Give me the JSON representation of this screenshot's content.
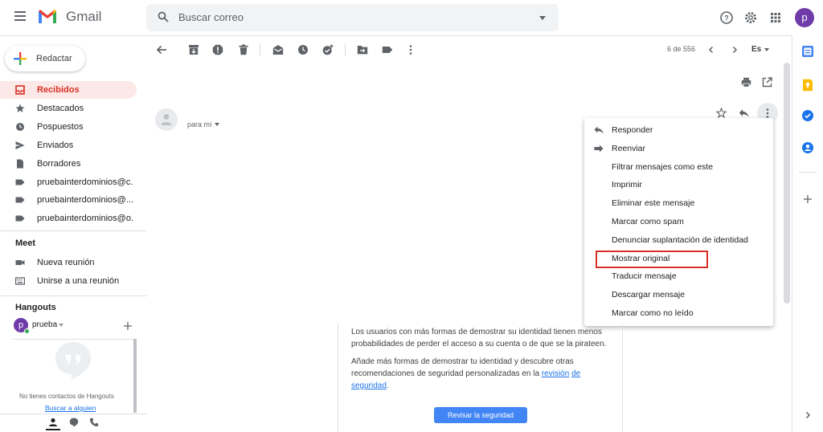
{
  "app": {
    "name": "Gmail"
  },
  "search": {
    "placeholder": "Buscar correo"
  },
  "sidebar": {
    "compose_label": "Redactar",
    "items": [
      {
        "label": "Recibidos",
        "icon": "inbox-icon",
        "active": true
      },
      {
        "label": "Destacados",
        "icon": "star-icon"
      },
      {
        "label": "Pospuestos",
        "icon": "clock-icon"
      },
      {
        "label": "Enviados",
        "icon": "send-icon"
      },
      {
        "label": "Borradores",
        "icon": "file-icon"
      },
      {
        "label": "pruebainterdominios@c...",
        "icon": "label-icon"
      },
      {
        "label": "pruebainterdominios@...",
        "icon": "label-icon"
      },
      {
        "label": "pruebainterdominios@o...",
        "icon": "label-icon"
      }
    ],
    "meet_title": "Meet",
    "meet_items": [
      {
        "label": "Nueva reunión",
        "icon": "video-icon"
      },
      {
        "label": "Unirse a una reunión",
        "icon": "keyboard-icon"
      }
    ],
    "hangouts_title": "Hangouts",
    "hangouts_user": "prueba",
    "hangouts_empty": "No tienes contactos de Hangouts",
    "hangouts_link": "Buscar a alguien"
  },
  "toolbar": {
    "pagination": "6 de 556",
    "language": "Es"
  },
  "message": {
    "to_me": "para mí"
  },
  "menu": {
    "items": [
      {
        "label": "Responder",
        "icon": "reply-icon"
      },
      {
        "label": "Reenviar",
        "icon": "forward-icon"
      },
      {
        "label": "Filtrar mensajes como este"
      },
      {
        "label": "Imprimir"
      },
      {
        "label": "Eliminar este mensaje"
      },
      {
        "label": "Marcar como spam"
      },
      {
        "label": "Denunciar suplantación de identidad"
      },
      {
        "label": "Mostrar original",
        "highlighted": true
      },
      {
        "label": "Traducir mensaje"
      },
      {
        "label": "Descargar mensaje"
      },
      {
        "label": "Marcar como no leído"
      }
    ]
  },
  "security": {
    "p1": "Los usuarios con más formas de demostrar su identidad tienen menos probabilidades de perder el acceso a su cuenta o de que se la pirateen.",
    "p2_start": "Añade más formas de demostrar tu identidad y descubre otras recomendaciones de seguridad personalizadas en la ",
    "p2_link_a": "revisión",
    "p2_link_b": "de seguridad",
    "p2_end": ".",
    "button": "Revisar la seguridad"
  },
  "user": {
    "initial": "p"
  },
  "colors": {
    "accent": "#d93025",
    "blue": "#1a73e8",
    "active_bg": "#fce8e6"
  }
}
